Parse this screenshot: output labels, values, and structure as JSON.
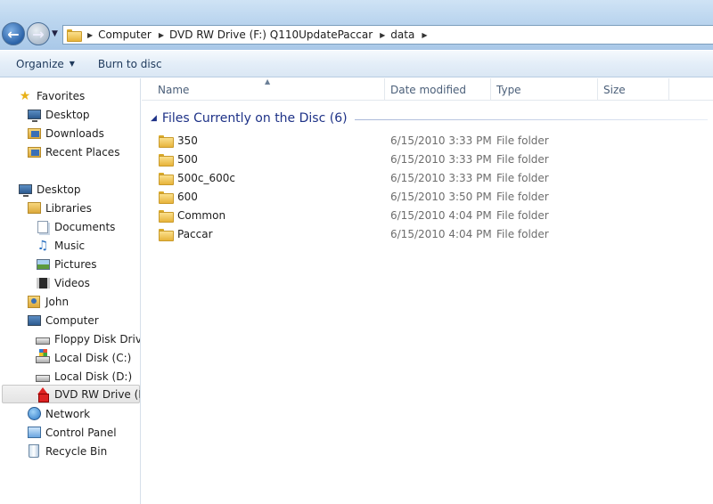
{
  "address": {
    "crumbs": [
      "Computer",
      "DVD RW Drive (F:) Q110UpdatePaccar",
      "data"
    ]
  },
  "toolbar": {
    "organize_label": "Organize",
    "burn_label": "Burn to disc"
  },
  "nav": {
    "favorites": "Favorites",
    "desktop_fav": "Desktop",
    "downloads": "Downloads",
    "recent": "Recent Places",
    "desktop": "Desktop",
    "libraries": "Libraries",
    "documents": "Documents",
    "music": "Music",
    "pictures": "Pictures",
    "videos": "Videos",
    "john": "John",
    "computer": "Computer",
    "floppy": "Floppy Disk Drive (",
    "local_c": "Local Disk (C:)",
    "local_d": "Local Disk (D:)",
    "dvd": "DVD RW Drive (F:)",
    "network": "Network",
    "control_panel": "Control Panel",
    "recycle_bin": "Recycle Bin"
  },
  "columns": {
    "name": "Name",
    "date": "Date modified",
    "type": "Type",
    "size": "Size"
  },
  "group": {
    "title": "Files Currently on the Disc (6)"
  },
  "files": [
    {
      "name": "350",
      "date": "6/15/2010 3:33 PM",
      "type": "File folder"
    },
    {
      "name": "500",
      "date": "6/15/2010 3:33 PM",
      "type": "File folder"
    },
    {
      "name": "500c_600c",
      "date": "6/15/2010 3:33 PM",
      "type": "File folder"
    },
    {
      "name": "600",
      "date": "6/15/2010 3:50 PM",
      "type": "File folder"
    },
    {
      "name": "Common",
      "date": "6/15/2010 4:04 PM",
      "type": "File folder"
    },
    {
      "name": "Paccar",
      "date": "6/15/2010 4:04 PM",
      "type": "File folder"
    }
  ]
}
